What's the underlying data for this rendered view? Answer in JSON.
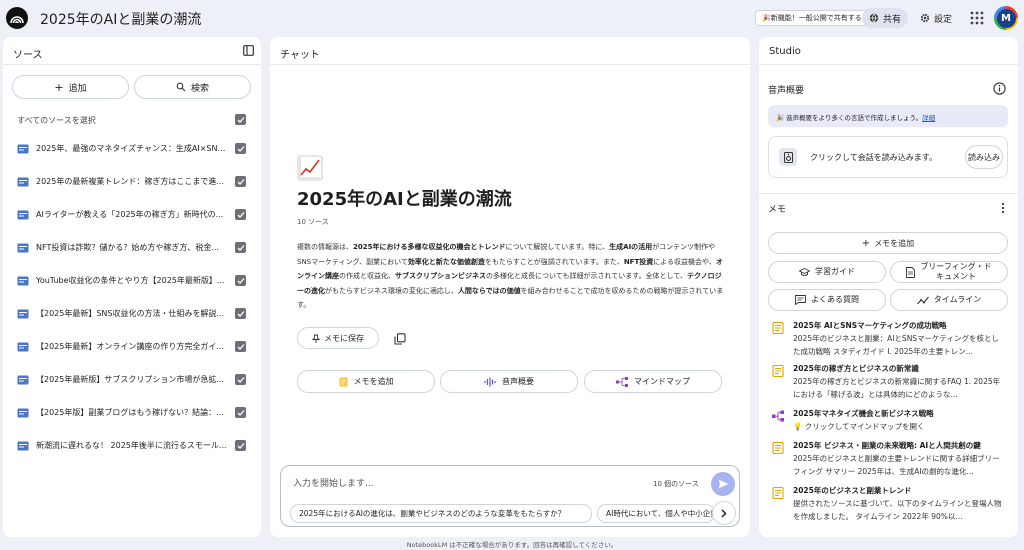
{
  "header": {
    "title": "2025年のAIと副業の潮流",
    "promo": "🎉新機能！一般公開で共有する",
    "share_label": "共有",
    "settings_label": "設定",
    "avatar_initial": "M"
  },
  "sources": {
    "title": "ソース",
    "add_label": "追加",
    "search_label": "検索",
    "select_all_label": "すべてのソースを選択",
    "items": [
      {
        "label": "2025年、最強のマネタイズチャンス：生成AI×SNS..."
      },
      {
        "label": "2025年の最新複業トレンド：稼ぎ方はここまで進..."
      },
      {
        "label": "AIライターが教える「2025年の稼ぎ方」新時代の..."
      },
      {
        "label": "NFT投資は詐欺？儲かる？始め方や稼ぎ方、税金..."
      },
      {
        "label": "YouTube収益化の条件とやり方【2025年最新版】..."
      },
      {
        "label": "【2025年最新】SNS収益化の方法・仕組みを解説..."
      },
      {
        "label": "【2025年最新】オンライン講座の作り方完全ガイ..."
      },
      {
        "label": "【2025年最新版】サブスクリプション市場が急拡..."
      },
      {
        "label": "【2025年版】副業ブログはもう稼げない？結論：..."
      },
      {
        "label": "新潮流に遅れるな！ 2025年後半に流行るスモール..."
      }
    ]
  },
  "chat": {
    "title": "チャット",
    "notebook_title": "2025年のAIと副業の潮流",
    "source_count": "10 ソース",
    "summary": {
      "p1": "複数の情報源は、",
      "b1": "2025年における多様な収益化の機会とトレンド",
      "p2": "について解説しています。特に、",
      "b2": "生成AIの活用",
      "p3": "がコンテンツ制作やSNSマーケティング、副業において",
      "b3": "効率化と新たな価値創造",
      "p4": "をもたらすことが強調されています。また、",
      "b4": "NFT投資",
      "p5": "による収益機会や、",
      "b5": "オンライン講座",
      "p6": "の作成と収益化、",
      "b6": "サブスクリプションビジネス",
      "p7": "の多様化と成長についても詳細が示されています。全体として、",
      "b7": "テクノロジーの進化",
      "p8": "がもたらすビジネス環境の変化に適応し、",
      "b8": "人間ならではの価値",
      "p9": "を組み合わせることで成功を収めるための戦略が提示されています。"
    },
    "save_memo_label": "メモに保存",
    "add_memo_label": "メモを追加",
    "audio_overview_label": "音声概要",
    "mindmap_label": "マインドマップ",
    "input_placeholder": "入力を開始します...",
    "input_source_count": "10 個のソース",
    "suggestions": [
      "2025年におけるAIの進化は、副業やビジネスのどのような変革をもたらすか？",
      "AI時代において、個人や中小企業"
    ]
  },
  "studio": {
    "title": "Studio",
    "audio_title": "音声概要",
    "banner_text": "🎉 音声概要をより多くの言語で作成しましょう。",
    "banner_link": "詳細",
    "load_text": "クリックして会話を読み込みます。",
    "load_button": "読み込み",
    "memo_title": "メモ",
    "add_memo": "メモを追加",
    "buttons": {
      "study_guide": "学習ガイド",
      "briefing": "ブリーフィング・ド\nキュメント",
      "faq": "よくある質問",
      "timeline": "タイムライン"
    },
    "notes": [
      {
        "icon": "note-icon",
        "title": "2025年 AIとSNSマーケティングの成功戦略",
        "body": "2025年のビジネスと副業：AIとSNSマーケティングを核とした成功戦略 スタディガイド I. 2025年の主要トレン..."
      },
      {
        "icon": "note-icon",
        "title": "2025年の稼ぎ方とビジネスの新常識",
        "body": "2025年の稼ぎ方とビジネスの新常識に関するFAQ 1. 2025年における「稼げる波」とは具体的にどのような..."
      },
      {
        "icon": "mindmap-icon",
        "title": "2025年マネタイズ機会と新ビジネス戦略",
        "body": "💡 クリックしてマインドマップを開く"
      },
      {
        "icon": "note-icon",
        "title": "2025年 ビジネス・副業の未来戦略: AIと人間共創の鍵",
        "body": "2025年のビジネスと副業の主要トレンドに関する詳細ブリーフィング サマリー 2025年は、生成AIの劇的な進化..."
      },
      {
        "icon": "note-icon",
        "title": "2025年のビジネスと副業トレンド",
        "body": "提供されたソースに基づいて、以下のタイムラインと登場人物を作成しました。 タイムライン 2022年 90%以..."
      }
    ]
  },
  "footer": "NotebookLM は不正確な場合があります。回答は再確認してください。"
}
